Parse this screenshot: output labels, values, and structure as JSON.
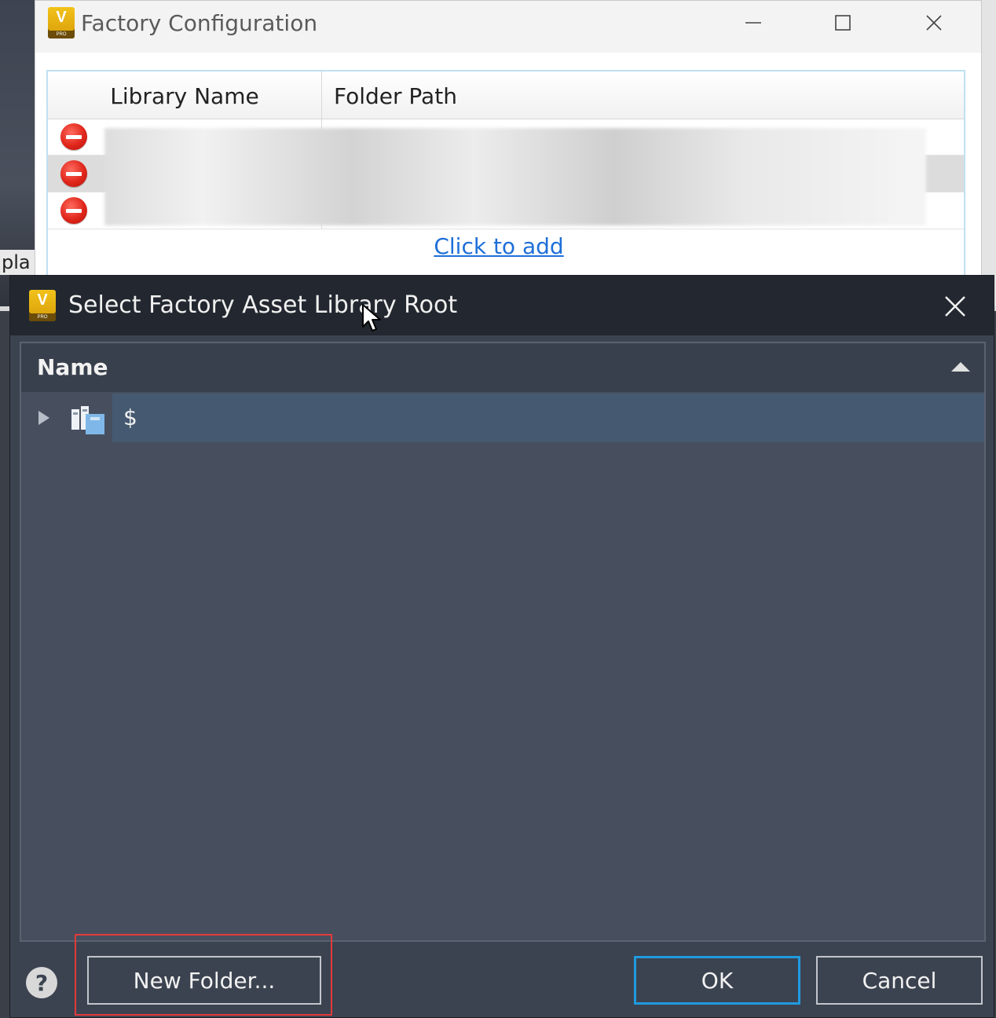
{
  "background": {
    "left_fragment_text": "pla"
  },
  "factory_window": {
    "title": "Factory Configuration",
    "icon": "vault-pro-app-icon",
    "app_icon_letter": "V",
    "app_icon_sub": "PRO",
    "controls": {
      "minimize_icon": "minimize-icon",
      "maximize_icon": "maximize-icon",
      "close_icon": "close-icon"
    },
    "grid": {
      "columns": [
        "Library Name",
        "Folder Path"
      ],
      "rows": [
        {
          "library_name": "",
          "folder_path": ""
        },
        {
          "library_name": "",
          "folder_path": ""
        },
        {
          "library_name": "",
          "folder_path": ""
        }
      ],
      "add_link": "Click to add"
    }
  },
  "select_dialog": {
    "title": "Select Factory Asset Library Root",
    "tree": {
      "header": "Name",
      "items": [
        {
          "label": "$",
          "icon": "vault-root-icon",
          "selected": true
        }
      ]
    },
    "buttons": {
      "new_folder": "New Folder...",
      "ok": "OK",
      "cancel": "Cancel"
    },
    "help_symbol": "?"
  },
  "colors": {
    "dialog_bg": "#3c4350",
    "titlebar_bg": "#232830",
    "selected_row": "#455a70",
    "ok_border": "#1f9be0",
    "highlight": "#e23a3a",
    "link": "#1e6fd8"
  }
}
